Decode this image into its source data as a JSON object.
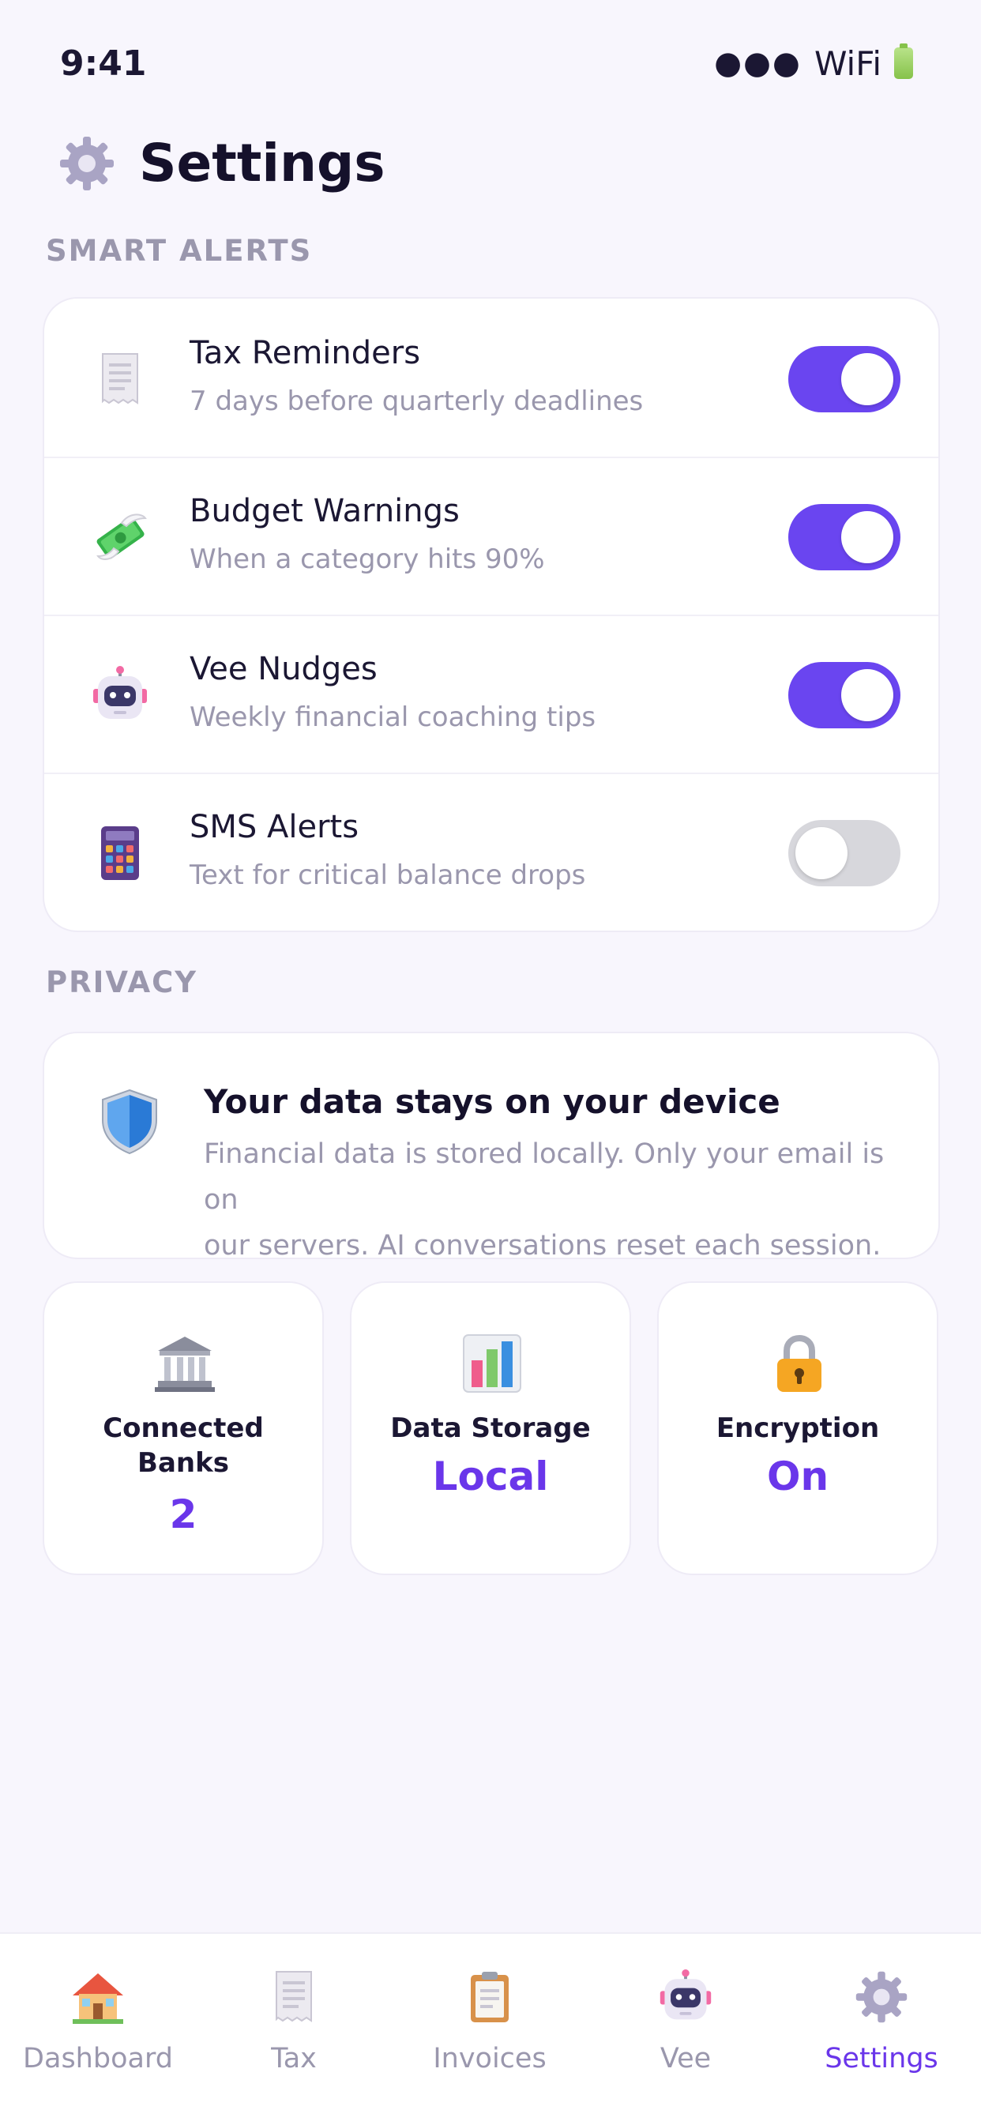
{
  "status": {
    "time": "9:41",
    "dots": "●●●",
    "wifi": "WiFi"
  },
  "header": {
    "title": "Settings"
  },
  "smart_alerts": {
    "section_label": "SMART ALERTS",
    "items": [
      {
        "title": "Tax Reminders",
        "subtitle": "7 days before quarterly deadlines",
        "enabled": true
      },
      {
        "title": "Budget Warnings",
        "subtitle": "When a category hits 90%",
        "enabled": true
      },
      {
        "title": "Vee Nudges",
        "subtitle": "Weekly financial coaching tips",
        "enabled": true
      },
      {
        "title": "SMS Alerts",
        "subtitle": "Text for critical balance drops",
        "enabled": false
      }
    ]
  },
  "privacy": {
    "section_label": "PRIVACY",
    "title": "Your data stays on your device",
    "body_line1": "Financial data is stored locally. Only your email is on",
    "body_line2": "our servers. AI conversations reset each session."
  },
  "stats": [
    {
      "label_line1": "Connected",
      "label_line2": "Banks",
      "value": "2"
    },
    {
      "label_line1": "Data Storage",
      "value": "Local"
    },
    {
      "label_line1": "Encryption",
      "value": "On"
    }
  ],
  "tabs": [
    {
      "label": "Dashboard",
      "icon": "house-icon"
    },
    {
      "label": "Tax",
      "icon": "receipt-icon"
    },
    {
      "label": "Invoices",
      "icon": "clipboard-icon"
    },
    {
      "label": "Vee",
      "icon": "robot-icon"
    },
    {
      "label": "Settings",
      "icon": "gear-icon",
      "active": true
    }
  ],
  "colors": {
    "accent": "#6a36ea",
    "toggle_on": "#6a45f0",
    "toggle_off": "#d7d7dc",
    "muted_text": "#9a97ad"
  }
}
